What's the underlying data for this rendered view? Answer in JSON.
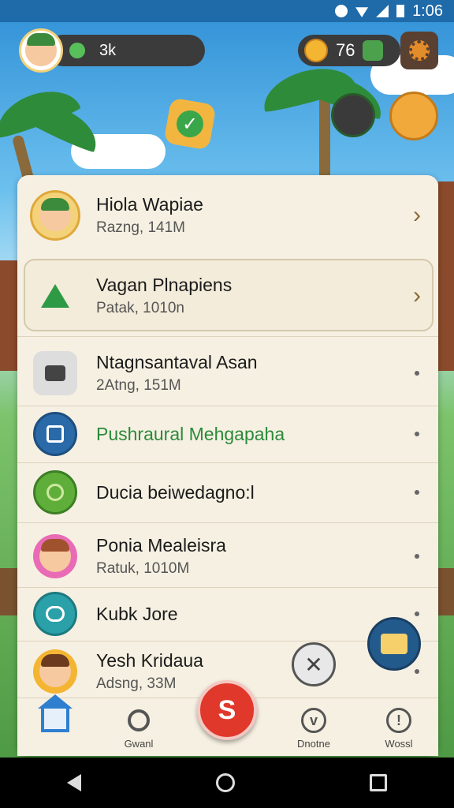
{
  "status_bar": {
    "time": "1:06"
  },
  "hud": {
    "gems": "3k",
    "coins": "76"
  },
  "list": [
    {
      "title": "Hiola Wapiae",
      "subtitle": "Razng, 141M",
      "trailing": "chevron"
    },
    {
      "title": "Vagan Plnapiens",
      "subtitle": "Patak, 1010n",
      "trailing": "chevron"
    },
    {
      "title": "Ntagnsantaval Asan",
      "subtitle": "2Atng, 151M",
      "trailing": "dot"
    },
    {
      "title": "Pushraural Mehgapaha",
      "subtitle": "",
      "trailing": "dot",
      "color": "#2a8a3a"
    },
    {
      "title": "Ducia beiwedagno:l",
      "subtitle": "",
      "trailing": "dot"
    },
    {
      "title": "Ponia Mealeisra",
      "subtitle": "Ratuk, 1010M",
      "trailing": "dot"
    },
    {
      "title": "Kubk Jore",
      "subtitle": "",
      "trailing": "dot"
    },
    {
      "title": "Yesh Kridaua",
      "subtitle": "Adsng, 33M",
      "trailing": "dot"
    }
  ],
  "bottom_nav": [
    {
      "label": "",
      "icon": "home-icon"
    },
    {
      "label": "Gwanl",
      "icon": "search-icon"
    },
    {
      "label": "Dnotne",
      "icon": "chevron-circle-icon"
    },
    {
      "label": "Wossl",
      "icon": "info-icon"
    }
  ],
  "colors": {
    "accent": "#2f7fd0",
    "fab": "#e0382a",
    "panel": "#f6f0e2"
  }
}
